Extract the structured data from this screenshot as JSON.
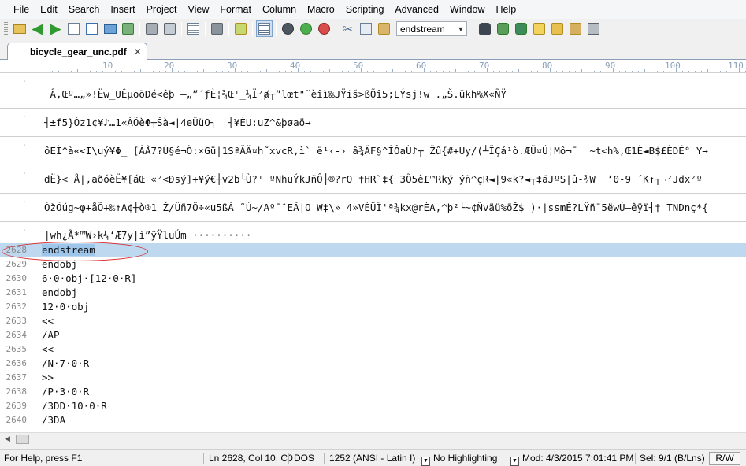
{
  "menu": [
    "File",
    "Edit",
    "Search",
    "Insert",
    "Project",
    "View",
    "Format",
    "Column",
    "Macro",
    "Scripting",
    "Advanced",
    "Window",
    "Help"
  ],
  "toolbar": {
    "search_combo_value": "endstream",
    "icons": [
      "open-icon",
      "back-arrow-icon",
      "forward-arrow-icon",
      "new-file-icon",
      "open-file-icon",
      "open-folder-icon",
      "save-icon",
      "print-icon",
      "print-preview-icon",
      "list-icon",
      "hex-icon",
      "column-mode-icon",
      "word-wrap-icon",
      "browser-icon",
      "globe-icon",
      "stop-icon",
      "cut-icon",
      "copy-icon",
      "paste-icon",
      "find-icon",
      "find-next-icon",
      "replace-icon",
      "find-in-files-icon",
      "macro-icon",
      "settings-icon",
      "expand-icon"
    ]
  },
  "tab": {
    "label": "bicycle_gear_unc.pdf",
    "close": "✕"
  },
  "ruler": {
    "labels": [
      "10",
      "20",
      "30",
      "40",
      "50",
      "60",
      "70",
      "80",
      "90",
      "100",
      "110"
    ]
  },
  "binary_lines": [
    " Â,Œº…„»!Ëw_UÊµoöDé<êþ –„”´ƒÈ¦¾Œ¹_¼Ï²ⱥ┬”lœt\"˜èîì‰JŸiš>ßÕî5;LÝsj!w .„Š.ükh%X«ÑŸ",
    "┤±f5}Òz1¢¥♪…1«ÀÖèΦ┬Šà◄|4eÛüO┐_¦┤¥ÉU:uZ^&þøaö→",
    "ôEÌ^à«<I\\uý¥Φ_ [ÂÅ7?Ù§é¬Ò:×Gü|1SªÄÄ¤h˜xvcR,ì` ë¹‹-› â¾ÄF§^ÎÔaÙ♪┬ Žû{#+Uy/(┴ÏÇá¹ò.ÆÜ¤Ú¦Mô¬¯  ~t<h%,Œ1È◄B$£ÈDÉ° Y→",
    "dË}< Å|,aðóèË¥[áŒ «²<Ðsý]+¥ý€┼v2b└Ù?¹ ºNhuÝkJñÔ├®?rO †HR`‡{ 3Õ5ê£™Rký ýñ^çR◄|9«k?◄┬‡äJºS|û-¾W  ‘0-9 ´K↑┐¬²Jdx²º",
    "ÒžÔúg~φ+åÕ+‰↑A¢┼ò®1 Ž/Ûñ7Ö÷«u5ßÁ ˜Ù~/Aº¯ˆEÂ|O W‡\\» 4»VÉÜÏ'ª¾kx@rÈA,^þ²└~¢Ñväü%õŽ$ )·|ssmÈ?LŸñ¯5ëwÙ—êÿï┤† TNDnç*{",
    "|wh¿Ã*™W›k¼‘Æ7y|ì”ÿŸluÚm ··········"
  ],
  "lines": [
    {
      "num": "2628",
      "text": "endstream",
      "selected": true
    },
    {
      "num": "2629",
      "text": "endobj"
    },
    {
      "num": "2630",
      "text": "6·0·obj·[12·0·R]"
    },
    {
      "num": "2631",
      "text": "endobj"
    },
    {
      "num": "2632",
      "text": "12·0·obj"
    },
    {
      "num": "2633",
      "text": "<<"
    },
    {
      "num": "2634",
      "text": "/AP"
    },
    {
      "num": "2635",
      "text": "<<"
    },
    {
      "num": "2636",
      "text": "/N·7·0·R"
    },
    {
      "num": "2637",
      "text": ">>"
    },
    {
      "num": "2638",
      "text": "/P·3·0·R"
    },
    {
      "num": "2639",
      "text": "/3DD·10·0·R"
    },
    {
      "num": "2640",
      "text": "/3DA"
    }
  ],
  "status": {
    "help": "For Help, press F1",
    "position": "Ln 2628, Col 10, C0",
    "line_ending": "DOS",
    "encoding": "1252  (ANSI - Latin I)",
    "highlighting": "No Highlighting",
    "modified": "Mod: 4/3/2015 7:01:41 PM",
    "selection": "Sel: 9/1 (B/Lns)",
    "rw": "R/W"
  },
  "colors": {
    "selection": "#bdd8ef",
    "annotation_circle": "#d8282c",
    "tab_border": "#8a9db5"
  }
}
